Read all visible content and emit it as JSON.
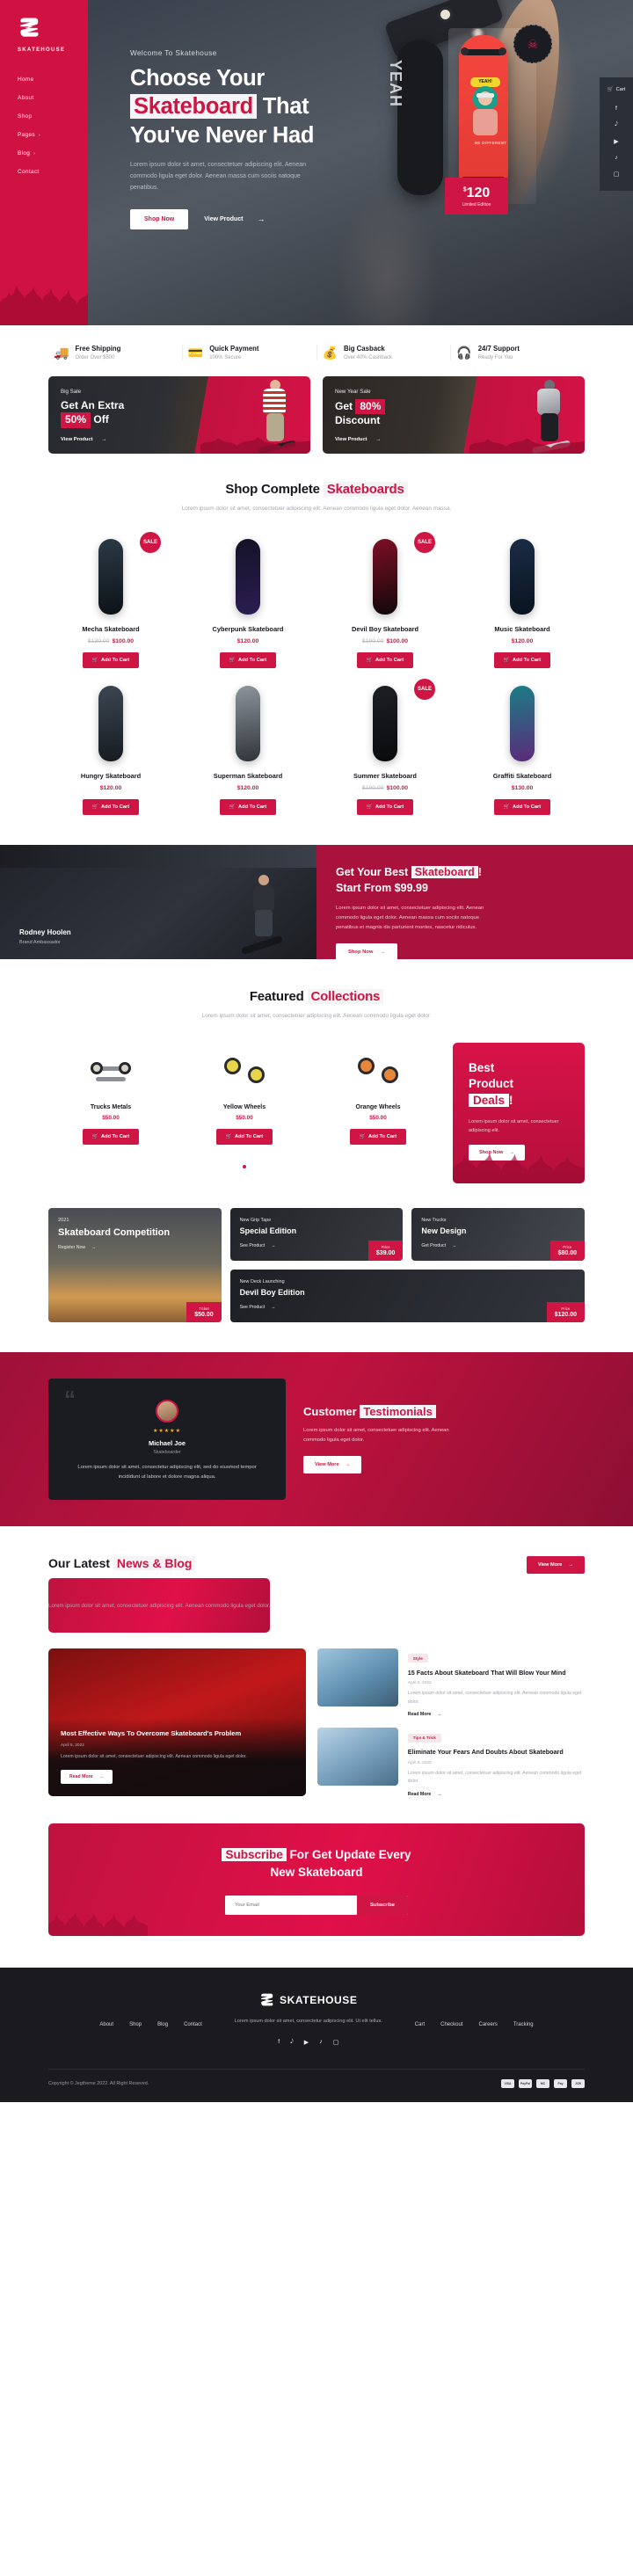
{
  "brand": {
    "name": "SKATEHOUSE",
    "accent": "#cf1543",
    "dark": "#1b1b1f"
  },
  "sidebar": {
    "items": [
      {
        "label": "Home",
        "caret": ""
      },
      {
        "label": "About",
        "caret": ""
      },
      {
        "label": "Shop",
        "caret": ""
      },
      {
        "label": "Pages",
        "caret": "›"
      },
      {
        "label": "Blog",
        "caret": "›"
      },
      {
        "label": "Contact",
        "caret": ""
      }
    ]
  },
  "social_rail": {
    "cart_label": "Cart",
    "icons": [
      "facebook",
      "twitter",
      "youtube",
      "tiktok",
      "instagram"
    ],
    "glyphs": [
      "f",
      "ᴠ",
      "▶",
      "♪",
      "▢"
    ]
  },
  "hero": {
    "welcome": "Welcome To Skatehouse",
    "title_line1": "Choose Your",
    "title_highlight": "Skateboard",
    "title_line2_rest": "That",
    "title_line3": "You've Never Had",
    "paragraph": "Lorem ipsum dolor sit amet, consectetuer adipiscing elit. Aenean commodo ligula eget dolor. Aenean massa cum sociis natoque penatibus.",
    "primary_btn": "Shop Now",
    "secondary_btn": "View Product",
    "card": {
      "deck_text": "YEAH",
      "bubble": "YEAH!",
      "caption": "BE DIFFERENT",
      "price": "120",
      "currency": "$",
      "edition": "Limited Edition",
      "badge": "☠"
    }
  },
  "features": [
    {
      "icon": "truck-icon",
      "glyph": "ὩA",
      "title": "Free Shipping",
      "sub": "Order Over $500"
    },
    {
      "icon": "card-icon",
      "glyph": "▤",
      "title": "Quick Payment",
      "sub": "100% Secure"
    },
    {
      "icon": "money-bag-icon",
      "glyph": "⬤",
      "title": "Big Casback",
      "sub": "Over 40% Cashback"
    },
    {
      "icon": "support-icon",
      "glyph": "☺",
      "title": "24/7 Support",
      "sub": "Ready For You"
    }
  ],
  "promos": [
    {
      "eyebrow": "Big Sale",
      "line1": "Get An Extra",
      "pct": "50%",
      "line2": "Off",
      "link": "View Product"
    },
    {
      "eyebrow": "New Year Sale",
      "line1": "Get",
      "pct": "80%",
      "line2": "Discount",
      "link": "View Product"
    }
  ],
  "shop": {
    "title_normal": "Shop Complete",
    "title_accent": "Skateboards",
    "subtitle": "Lorem ipsum dolor sit amet, consectetuer adipiscing elit. Aenean commodo ligula eget dolor. Aenean massa.",
    "add_to_cart": "Add To Cart",
    "sale_badge": "SALE",
    "products": [
      {
        "name": "Mecha Skateboard",
        "price": "$100.00",
        "old_price": "$130.00",
        "sale": true,
        "c1": "#2b3a47",
        "c2": "#0d1216"
      },
      {
        "name": "Cyberpunk Skateboard",
        "price": "$120.00",
        "old_price": "",
        "sale": false,
        "c1": "#141226",
        "c2": "#2a1d52"
      },
      {
        "name": "Devil Boy Skateboard",
        "price": "$100.00",
        "old_price": "$190.00",
        "sale": true,
        "c1": "#7d0f24",
        "c2": "#12080b"
      },
      {
        "name": "Music Skateboard",
        "price": "$120.00",
        "old_price": "",
        "sale": false,
        "c1": "#1a2c46",
        "c2": "#0a1320"
      },
      {
        "name": "Hungry Skateboard",
        "price": "$120.00",
        "old_price": "",
        "sale": false,
        "c1": "#3c4652",
        "c2": "#161b20"
      },
      {
        "name": "Superman Skateboard",
        "price": "$120.00",
        "old_price": "",
        "sale": false,
        "c1": "#8d949b",
        "c2": "#30353b"
      },
      {
        "name": "Summer Skateboard",
        "price": "$100.00",
        "old_price": "$190.00",
        "sale": true,
        "c1": "#1d1f24",
        "c2": "#0a0b0d"
      },
      {
        "name": "Graffiti Skateboard",
        "price": "$130.00",
        "old_price": "",
        "sale": false,
        "c1": "#1b7d86",
        "c2": "#5b2a7a"
      }
    ]
  },
  "ambassador": {
    "name": "Rodney Hoolen",
    "role": "Brand Ambassador",
    "title_a": "Get Your Best",
    "title_hl": "Skateboard",
    "title_b": "!",
    "title_line2": "Start From $99.99",
    "paragraph": "Lorem ipsum dolor sit amet, consectetuer adipiscing elit. Aenean commodo ligula eget dolor. Aenean massa cum sociis natoque penatibus et magnis dis parturient montes, nascetur ridiculus.",
    "btn": "Shop Now"
  },
  "collections": {
    "title_normal": "Featured",
    "title_accent": "Collections",
    "subtitle": "Lorem ipsum dolor sit amet, consectetuer adipiscing elit. Aenean commodo ligula eget dolor.",
    "add_to_cart": "Add To Cart",
    "items": [
      {
        "name": "Trucks Metals",
        "price": "$50.00",
        "kind": "truck"
      },
      {
        "name": "Yellow Wheels",
        "price": "$50.00",
        "kind": "wheels",
        "color": "#e8d64a"
      },
      {
        "name": "Orange Wheels",
        "price": "$50.00",
        "kind": "wheels",
        "color": "#e8863a"
      }
    ],
    "best": {
      "l1": "Best",
      "l2": "Product",
      "l3": "Deals",
      "excl": "!",
      "paragraph": "Lorem ipsum dolor sit amet, consectetuer adipiscing elit.",
      "btn": "Shop Now"
    }
  },
  "tiles": [
    {
      "name": "competition",
      "year": "2021",
      "title": "Skateboard Competition",
      "link": "Register Now",
      "price_label": "Ticket",
      "price": "$50.00"
    },
    {
      "name": "grip-tape",
      "eyebrow": "New Grip Tape",
      "title": "Special Edition",
      "link": "See Product",
      "price_label": "Price",
      "price": "$39.00"
    },
    {
      "name": "trucks",
      "eyebrow": "New Trucks",
      "title": "New Design",
      "link": "Get Product",
      "price_label": "Price",
      "price": "$80.00"
    },
    {
      "name": "deck",
      "eyebrow": "New Deck Launching",
      "title": "Devil Boy Edition",
      "link": "See Product",
      "price_label": "Price",
      "price": "$120.00"
    }
  ],
  "testimonials": {
    "title_normal": "Customer",
    "title_accent": "Testimonials",
    "paragraph": "Lorem ipsum dolor sit amet, consectetuer adipiscing elit. Aenean commodo ligula eget dolor.",
    "btn": "View More",
    "card": {
      "stars": "★★★★★",
      "name": "Michael Joe",
      "role": "Skateboarder",
      "text": "Lorem ipsum dolor sit amet, consectetur adipiscing elit, sed do eiusmod tempor incididunt ut labore et dolore magna aliqua.",
      "quote_mark": "“"
    }
  },
  "blog": {
    "title_normal": "Our Latest",
    "title_accent": "News & Blog",
    "subtitle": "Lorem ipsum dolor sit amet, consectetuer adipiscing elit. Aenean commodo ligula eget dolor.",
    "view_more": "View More",
    "read_more": "Read More",
    "featured": {
      "title": "Most Effective Ways To Overcome Skateboard's Problem",
      "meta": "April 5, 2022",
      "excerpt": "Lorem ipsum dolor sit amet, consectetuer adipiscing elit. Aenean commodo ligula eget dolor."
    },
    "posts": [
      {
        "tag": "Style",
        "title": "15 Facts About Skateboard That Will Blow Your Mind",
        "meta": "April 5, 2022",
        "excerpt": "Lorem ipsum dolor sit amet, consectetuer adipiscing elit. Aenean commodo ligula eget dolor."
      },
      {
        "tag": "Tips & Trick",
        "title": "Eliminate Your Fears And Doubts About Skateboard",
        "meta": "April 5, 2022",
        "excerpt": "Lorem ipsum dolor sit amet, consectetuer adipiscing elit. Aenean commodo ligula eget dolor."
      }
    ]
  },
  "subscribe": {
    "l1_a": "Subscribe",
    "l1_b": "For Get Update Every",
    "l2": "New Skateboard",
    "placeholder": "Your Email",
    "btn": "Subscribe"
  },
  "footer": {
    "brand": "SKATEHOUSE",
    "description": "Lorem ipsum dolor sit amet, consectetur adipiscing elit. Ut elit tellus.",
    "left_links": [
      "About",
      "Shop",
      "Blog",
      "Contact"
    ],
    "right_links": [
      "Cart",
      "Checkout",
      "Careers",
      "Tracking"
    ],
    "socials": [
      "f",
      "ᴠ",
      "▶",
      "♪",
      "▢"
    ],
    "copyright": "Copyright © Jegtheme 2022. All Right Reseved.",
    "payments": [
      "VISA",
      "PayPal",
      "MC",
      "Pay",
      "JCB"
    ]
  }
}
